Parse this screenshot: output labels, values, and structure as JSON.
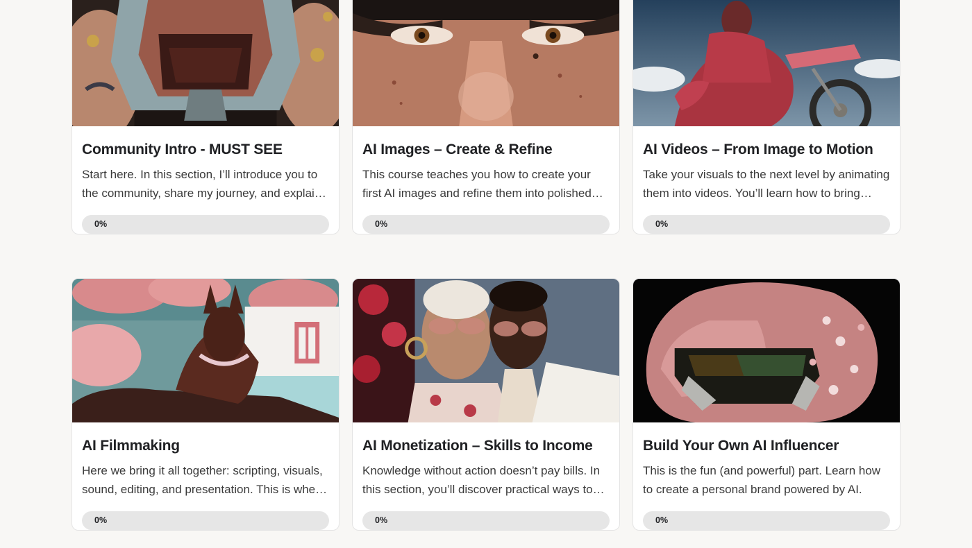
{
  "courses": [
    {
      "title": "Community Intro - MUST SEE",
      "description": "Start here. In this section, I’ll introduce you to the community, share my journey, and explain how everything works.",
      "progress_label": "0%",
      "progress": 0,
      "image_icon": "helmet-portrait-image"
    },
    {
      "title": "AI Images – Create & Refine",
      "description": "This course teaches you how to create your first AI images and refine them into polished visuals.",
      "progress_label": "0%",
      "progress": 0,
      "image_icon": "eyes-closeup-image"
    },
    {
      "title": "AI Videos – From Image to Motion",
      "description": "Take your visuals to the next level by animating them into videos. You’ll learn how to bring images to life.",
      "progress_label": "0%",
      "progress": 0,
      "image_icon": "motorbike-rider-image"
    },
    {
      "title": "AI Filmmaking",
      "description": "Here we bring it all together: scripting, visuals, sound, editing, and presentation. This is where it all comes together.",
      "progress_label": "0%",
      "progress": 0,
      "image_icon": "doberman-pool-image"
    },
    {
      "title": "AI Monetization – Skills to Income",
      "description": "Knowledge without action doesn’t pay bills. In this section, you’ll discover practical ways to earn with AI.",
      "progress_label": "0%",
      "progress": 0,
      "image_icon": "fashion-couple-image"
    },
    {
      "title": "Build Your Own AI Influencer",
      "description": "This is the fun (and powerful) part. Learn how to create a personal brand powered by AI.",
      "progress_label": "0%",
      "progress": 0,
      "image_icon": "floral-helmet-image"
    }
  ],
  "colors": {
    "page_background": "#f8f7f5",
    "card_background": "#ffffff",
    "progress_track": "#e6e6e6",
    "accent_pink": "#c9646a"
  }
}
